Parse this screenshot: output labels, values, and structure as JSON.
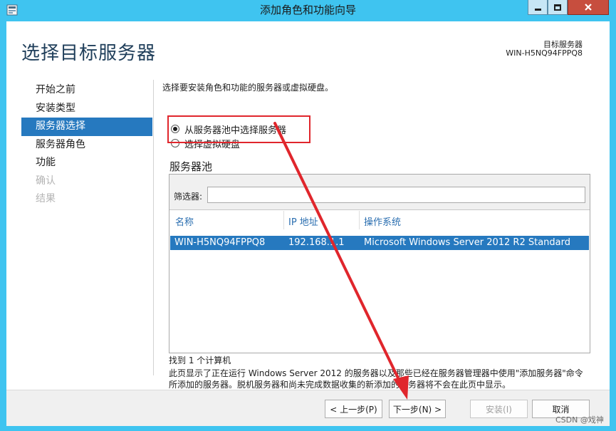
{
  "window": {
    "title": "添加角色和功能向导",
    "min_glyph": "▁",
    "max_glyph": "□",
    "close_glyph": "✕"
  },
  "header": {
    "page_title": "选择目标服务器",
    "dest_label": "目标服务器",
    "dest_value": "WIN-H5NQ94FPPQ8"
  },
  "nav": {
    "items": [
      {
        "label": "开始之前"
      },
      {
        "label": "安装类型"
      },
      {
        "label": "服务器选择"
      },
      {
        "label": "服务器角色"
      },
      {
        "label": "功能"
      },
      {
        "label": "确认"
      },
      {
        "label": "结果"
      }
    ],
    "active_index": 2
  },
  "content": {
    "intro": "选择要安装角色和功能的服务器或虚拟硬盘。",
    "radio_pool": "从服务器池中选择服务器",
    "radio_vhd": "选择虚拟硬盘",
    "pool_title": "服务器池",
    "filter_label": "筛选器:",
    "filter_value": "",
    "columns": [
      "名称",
      "IP 地址",
      "操作系统"
    ],
    "rows": [
      {
        "name": "WIN-H5NQ94FPPQ8",
        "ip": "192.168.1.1",
        "os": "Microsoft Windows Server 2012 R2 Standard"
      }
    ],
    "found": "找到 1 个计算机",
    "description": "此页显示了正在运行 Windows Server 2012 的服务器以及那些已经在服务器管理器中使用\"添加服务器\"命令所添加的服务器。脱机服务器和尚未完成数据收集的新添加的服务器将不会在此页中显示。"
  },
  "footer": {
    "back": "< 上一步(P)",
    "next": "下一步(N) >",
    "install": "安装(I)",
    "cancel": "取消"
  },
  "watermark": "CSDN @戏神",
  "colors": {
    "titlebar": "#3fc4f0",
    "selection": "#2679bf",
    "annotation": "#e0262c"
  }
}
